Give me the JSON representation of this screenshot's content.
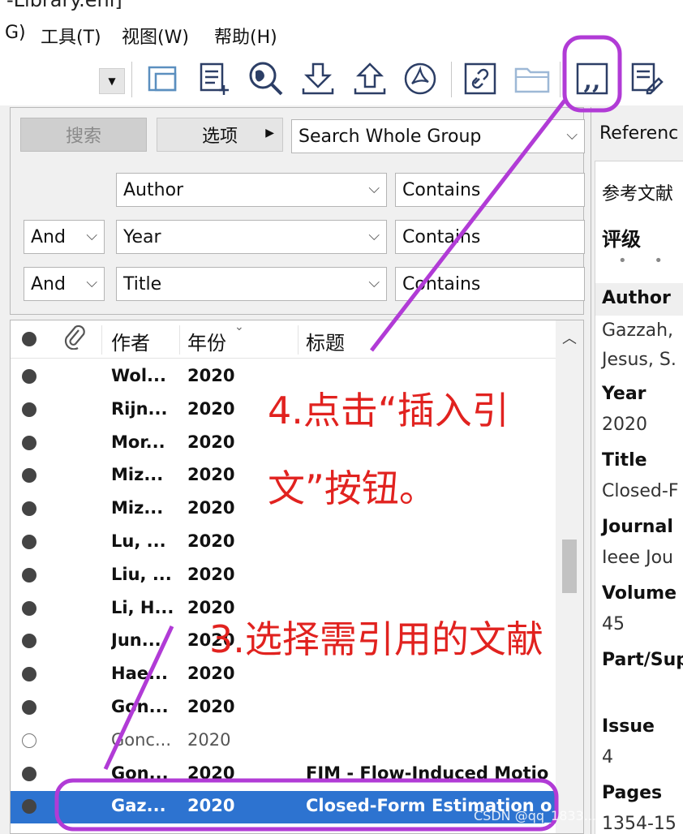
{
  "window": {
    "title": "-Library.enl]"
  },
  "menu": [
    "G)",
    "工具(T)",
    "视图(W)",
    "帮助(H)"
  ],
  "toolbar": {
    "icons": [
      "new-group-icon",
      "new-reference-icon",
      "online-search-icon",
      "import-icon",
      "export-icon",
      "find-pdf-icon",
      "open-link-icon",
      "open-file-icon",
      "insert-citation-icon",
      "format-bibliography-icon"
    ]
  },
  "search": {
    "search_button": "搜索",
    "options_button": "选项",
    "scope": "Search Whole Group",
    "rows": [
      {
        "bool": "",
        "field": "Author",
        "op": "Contains"
      },
      {
        "bool": "And",
        "field": "Year",
        "op": "Contains"
      },
      {
        "bool": "And",
        "field": "Title",
        "op": "Contains"
      }
    ]
  },
  "list": {
    "headers": {
      "author": "作者",
      "year": "年份",
      "title": "标题"
    },
    "rows": [
      {
        "author": "Wol...",
        "year": "2020",
        "title": "",
        "read": false
      },
      {
        "author": "Rijn...",
        "year": "2020",
        "title": "",
        "read": false
      },
      {
        "author": "Mor...",
        "year": "2020",
        "title": "",
        "read": false
      },
      {
        "author": "Miz...",
        "year": "2020",
        "title": "",
        "read": false
      },
      {
        "author": "Miz...",
        "year": "2020",
        "title": "",
        "read": false
      },
      {
        "author": "Lu, ...",
        "year": "2020",
        "title": "",
        "read": false
      },
      {
        "author": "Liu, ...",
        "year": "2020",
        "title": "",
        "read": false
      },
      {
        "author": "Li, H...",
        "year": "2020",
        "title": "",
        "read": false
      },
      {
        "author": "Jun...",
        "year": "2020",
        "title": "",
        "read": false
      },
      {
        "author": "Hae...",
        "year": "2020",
        "title": "",
        "read": false
      },
      {
        "author": "Gon...",
        "year": "2020",
        "title": "",
        "read": false
      },
      {
        "author": "Gonc...",
        "year": "2020",
        "title": "",
        "read": true
      },
      {
        "author": "Gon...",
        "year": "2020",
        "title": "FIM - Flow-Induced Motio",
        "read": false
      },
      {
        "author": "Gaz...",
        "year": "2020",
        "title": "Closed-Form Estimation o",
        "read": false,
        "selected": true
      }
    ]
  },
  "right_panel": {
    "tab": "Referenc",
    "ref_type": "参考文献",
    "rating_label": "评级",
    "rating_dots": "• •",
    "fields": [
      {
        "label": "Author",
        "value1": "Gazzah,",
        "value2": "Jesus, S."
      },
      {
        "label": "Year",
        "value1": "2020"
      },
      {
        "label": "Title",
        "value1": "Closed-F"
      },
      {
        "label": "Journal",
        "value1": "Ieee Jou"
      },
      {
        "label": "Volume",
        "value1": "45"
      },
      {
        "label": "Part/Sup",
        "value1": ""
      },
      {
        "label": "Issue",
        "value1": "4"
      },
      {
        "label": "Pages",
        "value1": "1354-15"
      }
    ]
  },
  "annotations": {
    "step4_line1": "4.点击“插入引",
    "step4_line2": "文”按钮。",
    "step3": "3.选择需引用的文献",
    "color": "#e1221f",
    "highlight_color": "#b13bd6"
  },
  "watermark": "CSDN @qq_1833..."
}
